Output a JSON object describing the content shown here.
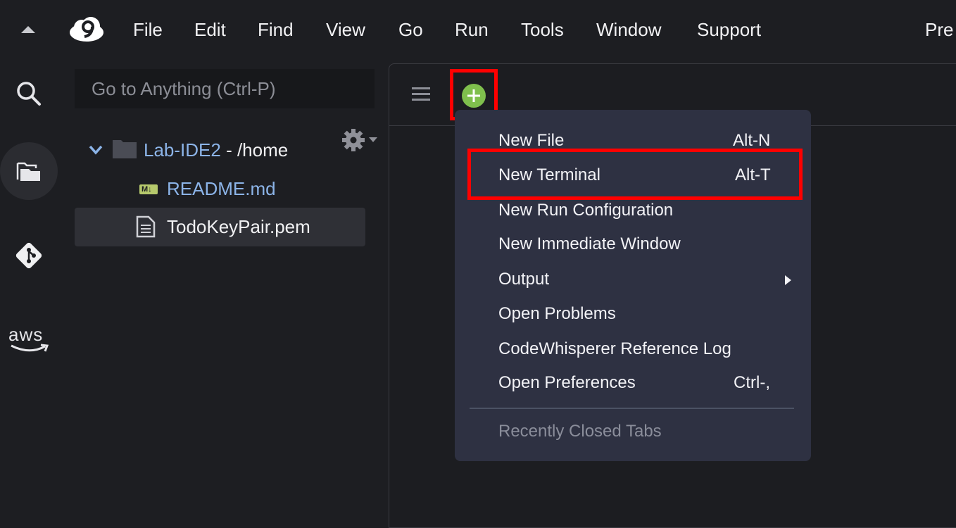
{
  "menubar": {
    "items": [
      "File",
      "Edit",
      "Find",
      "View",
      "Go",
      "Run",
      "Tools",
      "Window",
      "Support"
    ],
    "right_cut": "Pre"
  },
  "activity": {
    "icons": [
      "search-icon",
      "files-icon",
      "git-icon",
      "aws-icon"
    ],
    "aws_label": "aws"
  },
  "goto": {
    "placeholder": "Go to Anything (Ctrl-P)"
  },
  "tree": {
    "project_name": "Lab-IDE2",
    "project_path": " - /home",
    "files": [
      "README.md",
      "TodoKeyPair.pem"
    ]
  },
  "dropdown": {
    "items": [
      {
        "label": "New File",
        "shortcut": "Alt-N"
      },
      {
        "label": "New Terminal",
        "shortcut": "Alt-T"
      },
      {
        "label": "New Run Configuration",
        "shortcut": ""
      },
      {
        "label": "New Immediate Window",
        "shortcut": ""
      },
      {
        "label": "Output",
        "shortcut": ""
      },
      {
        "label": "Open Problems",
        "shortcut": ""
      },
      {
        "label": "CodeWhisperer Reference Log",
        "shortcut": ""
      },
      {
        "label": "Open Preferences",
        "shortcut": "Ctrl-,"
      }
    ],
    "recent_label": "Recently Closed Tabs"
  },
  "colors": {
    "highlight": "#ff0000",
    "plus_button": "#7fbf4d",
    "menu_bg": "#2e3142",
    "link_blue": "#8cb4e8"
  }
}
